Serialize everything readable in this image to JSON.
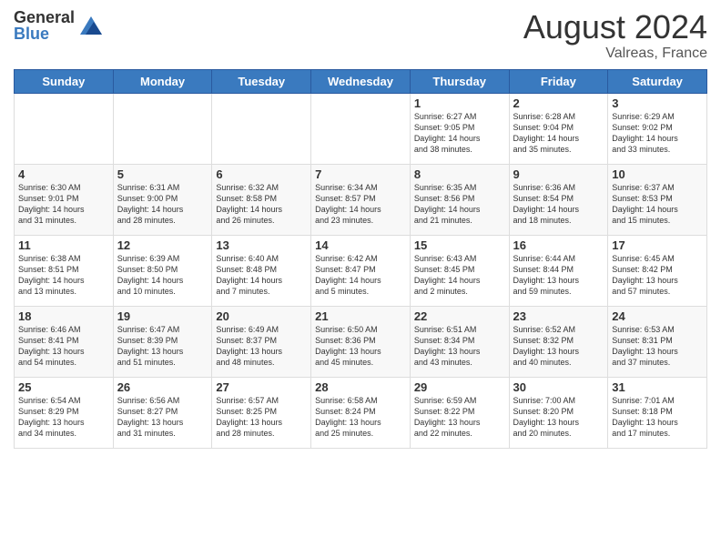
{
  "header": {
    "logo_general": "General",
    "logo_blue": "Blue",
    "title": "August 2024",
    "subtitle": "Valreas, France"
  },
  "weekdays": [
    "Sunday",
    "Monday",
    "Tuesday",
    "Wednesday",
    "Thursday",
    "Friday",
    "Saturday"
  ],
  "weeks": [
    [
      {
        "day": "",
        "info": ""
      },
      {
        "day": "",
        "info": ""
      },
      {
        "day": "",
        "info": ""
      },
      {
        "day": "",
        "info": ""
      },
      {
        "day": "1",
        "info": "Sunrise: 6:27 AM\nSunset: 9:05 PM\nDaylight: 14 hours\nand 38 minutes."
      },
      {
        "day": "2",
        "info": "Sunrise: 6:28 AM\nSunset: 9:04 PM\nDaylight: 14 hours\nand 35 minutes."
      },
      {
        "day": "3",
        "info": "Sunrise: 6:29 AM\nSunset: 9:02 PM\nDaylight: 14 hours\nand 33 minutes."
      }
    ],
    [
      {
        "day": "4",
        "info": "Sunrise: 6:30 AM\nSunset: 9:01 PM\nDaylight: 14 hours\nand 31 minutes."
      },
      {
        "day": "5",
        "info": "Sunrise: 6:31 AM\nSunset: 9:00 PM\nDaylight: 14 hours\nand 28 minutes."
      },
      {
        "day": "6",
        "info": "Sunrise: 6:32 AM\nSunset: 8:58 PM\nDaylight: 14 hours\nand 26 minutes."
      },
      {
        "day": "7",
        "info": "Sunrise: 6:34 AM\nSunset: 8:57 PM\nDaylight: 14 hours\nand 23 minutes."
      },
      {
        "day": "8",
        "info": "Sunrise: 6:35 AM\nSunset: 8:56 PM\nDaylight: 14 hours\nand 21 minutes."
      },
      {
        "day": "9",
        "info": "Sunrise: 6:36 AM\nSunset: 8:54 PM\nDaylight: 14 hours\nand 18 minutes."
      },
      {
        "day": "10",
        "info": "Sunrise: 6:37 AM\nSunset: 8:53 PM\nDaylight: 14 hours\nand 15 minutes."
      }
    ],
    [
      {
        "day": "11",
        "info": "Sunrise: 6:38 AM\nSunset: 8:51 PM\nDaylight: 14 hours\nand 13 minutes."
      },
      {
        "day": "12",
        "info": "Sunrise: 6:39 AM\nSunset: 8:50 PM\nDaylight: 14 hours\nand 10 minutes."
      },
      {
        "day": "13",
        "info": "Sunrise: 6:40 AM\nSunset: 8:48 PM\nDaylight: 14 hours\nand 7 minutes."
      },
      {
        "day": "14",
        "info": "Sunrise: 6:42 AM\nSunset: 8:47 PM\nDaylight: 14 hours\nand 5 minutes."
      },
      {
        "day": "15",
        "info": "Sunrise: 6:43 AM\nSunset: 8:45 PM\nDaylight: 14 hours\nand 2 minutes."
      },
      {
        "day": "16",
        "info": "Sunrise: 6:44 AM\nSunset: 8:44 PM\nDaylight: 13 hours\nand 59 minutes."
      },
      {
        "day": "17",
        "info": "Sunrise: 6:45 AM\nSunset: 8:42 PM\nDaylight: 13 hours\nand 57 minutes."
      }
    ],
    [
      {
        "day": "18",
        "info": "Sunrise: 6:46 AM\nSunset: 8:41 PM\nDaylight: 13 hours\nand 54 minutes."
      },
      {
        "day": "19",
        "info": "Sunrise: 6:47 AM\nSunset: 8:39 PM\nDaylight: 13 hours\nand 51 minutes."
      },
      {
        "day": "20",
        "info": "Sunrise: 6:49 AM\nSunset: 8:37 PM\nDaylight: 13 hours\nand 48 minutes."
      },
      {
        "day": "21",
        "info": "Sunrise: 6:50 AM\nSunset: 8:36 PM\nDaylight: 13 hours\nand 45 minutes."
      },
      {
        "day": "22",
        "info": "Sunrise: 6:51 AM\nSunset: 8:34 PM\nDaylight: 13 hours\nand 43 minutes."
      },
      {
        "day": "23",
        "info": "Sunrise: 6:52 AM\nSunset: 8:32 PM\nDaylight: 13 hours\nand 40 minutes."
      },
      {
        "day": "24",
        "info": "Sunrise: 6:53 AM\nSunset: 8:31 PM\nDaylight: 13 hours\nand 37 minutes."
      }
    ],
    [
      {
        "day": "25",
        "info": "Sunrise: 6:54 AM\nSunset: 8:29 PM\nDaylight: 13 hours\nand 34 minutes."
      },
      {
        "day": "26",
        "info": "Sunrise: 6:56 AM\nSunset: 8:27 PM\nDaylight: 13 hours\nand 31 minutes."
      },
      {
        "day": "27",
        "info": "Sunrise: 6:57 AM\nSunset: 8:25 PM\nDaylight: 13 hours\nand 28 minutes."
      },
      {
        "day": "28",
        "info": "Sunrise: 6:58 AM\nSunset: 8:24 PM\nDaylight: 13 hours\nand 25 minutes."
      },
      {
        "day": "29",
        "info": "Sunrise: 6:59 AM\nSunset: 8:22 PM\nDaylight: 13 hours\nand 22 minutes."
      },
      {
        "day": "30",
        "info": "Sunrise: 7:00 AM\nSunset: 8:20 PM\nDaylight: 13 hours\nand 20 minutes."
      },
      {
        "day": "31",
        "info": "Sunrise: 7:01 AM\nSunset: 8:18 PM\nDaylight: 13 hours\nand 17 minutes."
      }
    ]
  ],
  "colors": {
    "header_bg": "#3a7abf",
    "header_text": "#ffffff",
    "logo_blue": "#3a7abf"
  }
}
